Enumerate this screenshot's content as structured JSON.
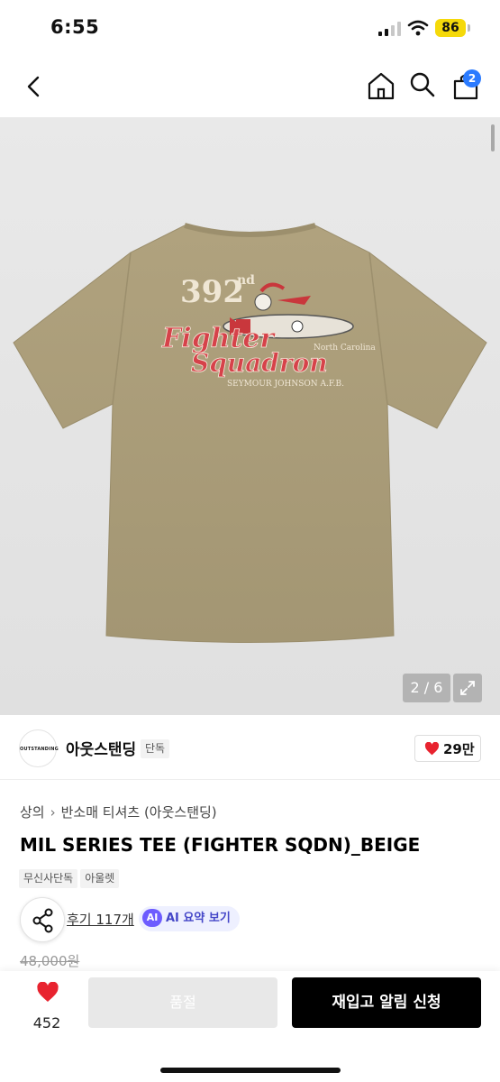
{
  "status_bar": {
    "time": "6:55",
    "battery": "86"
  },
  "nav": {
    "cart_count": "2",
    "icons": [
      "back-icon",
      "home-icon",
      "search-icon",
      "cart-icon"
    ]
  },
  "gallery": {
    "counter": "2 / 6",
    "print_text": {
      "number": "392",
      "suffix": "nd",
      "line1": "Fighter",
      "line2": "Squadron",
      "location": "North Carolina",
      "base": "SEYMOUR JOHNSON A.F.B."
    }
  },
  "brand": {
    "logo_text": "OUTSTANDING",
    "name": "아웃스탠딩",
    "tag": "단독",
    "like_count": "29만"
  },
  "product": {
    "breadcrumb": [
      "상의",
      "반소매 티셔츠 (아웃스탠딩)"
    ],
    "title": "MIL SERIES TEE (FIGHTER SQDN)_BEIGE",
    "tags": [
      "무신사단독",
      "아울렛"
    ],
    "review_link": "후기 117개",
    "ai_badge": "AI",
    "ai_summary": "AI 요약 보기",
    "price": "48,000원"
  },
  "bottom_bar": {
    "wish_count": "452",
    "soldout_label": "품절",
    "restock_label": "재입고 알림 신청"
  },
  "colors": {
    "accent_red": "#e8232f",
    "badge_blue": "#2b7bff",
    "ai_purple": "#6d5cff",
    "shirt_beige": "#a89a76"
  }
}
